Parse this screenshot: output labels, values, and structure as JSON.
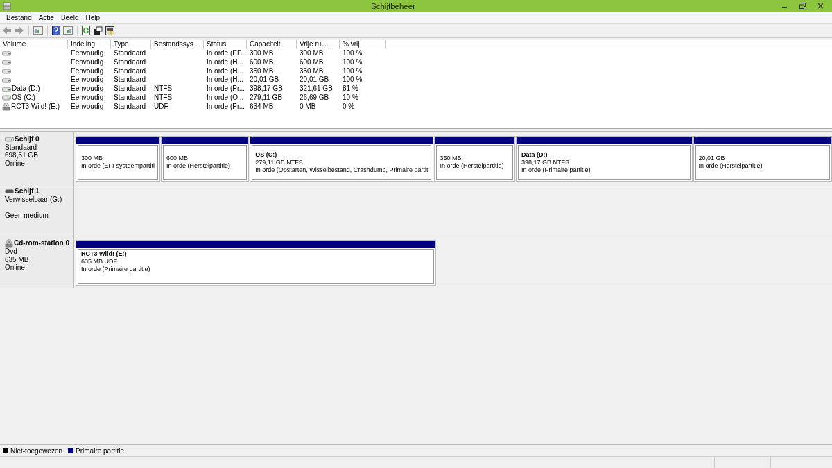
{
  "window": {
    "title": "Schijfbeheer"
  },
  "menu": [
    "Bestand",
    "Actie",
    "Beeld",
    "Help"
  ],
  "volumes": {
    "columns": [
      "Volume",
      "Indeling",
      "Type",
      "Bestandssys...",
      "Status",
      "Capaciteit",
      "Vrije rui...",
      "% vrij"
    ],
    "rows": [
      {
        "kind": "drive",
        "cells": [
          "",
          "Eenvoudig",
          "Standaard",
          "",
          "In orde (EF...",
          "300 MB",
          "300 MB",
          "100 %"
        ]
      },
      {
        "kind": "drive",
        "cells": [
          "",
          "Eenvoudig",
          "Standaard",
          "",
          "In orde (H...",
          "600 MB",
          "600 MB",
          "100 %"
        ]
      },
      {
        "kind": "drive",
        "cells": [
          "",
          "Eenvoudig",
          "Standaard",
          "",
          "In orde (H...",
          "350 MB",
          "350 MB",
          "100 %"
        ]
      },
      {
        "kind": "drive",
        "cells": [
          "",
          "Eenvoudig",
          "Standaard",
          "",
          "In orde (H...",
          "20,01 GB",
          "20,01 GB",
          "100 %"
        ]
      },
      {
        "kind": "drive",
        "cells": [
          "Data (D:)",
          "Eenvoudig",
          "Standaard",
          "NTFS",
          "In orde (Pr...",
          "398,17 GB",
          "321,61 GB",
          "81 %"
        ]
      },
      {
        "kind": "drive",
        "cells": [
          "OS (C:)",
          "Eenvoudig",
          "Standaard",
          "NTFS",
          "In orde (O...",
          "279,11 GB",
          "26,69 GB",
          "10 %"
        ]
      },
      {
        "kind": "cdrom",
        "cells": [
          "RCT3 Wild! (E:)",
          "Eenvoudig",
          "Standaard",
          "UDF",
          "In orde (Pr...",
          "634 MB",
          "0 MB",
          "0 %"
        ]
      }
    ]
  },
  "disks": [
    {
      "kind": "disk",
      "name": "Schijf 0",
      "info": [
        "Standaard",
        "698,51 GB",
        "Online"
      ],
      "partitions": [
        {
          "size": "300 MB",
          "status": "In orde (EFI-systeempartiti"
        },
        {
          "size": "600 MB",
          "status": "In orde (Herstelpartitie)"
        },
        {
          "title": "OS  (C:)",
          "size": "279,11 GB NTFS",
          "status": "In orde (Opstarten, Wisselbestand, Crashdump, Primaire partit"
        },
        {
          "size": "350 MB",
          "status": "In orde (Herstelpartitie)"
        },
        {
          "title": "Data  (D:)",
          "size": "398,17 GB NTFS",
          "status": "In orde (Primaire partitie)"
        },
        {
          "size": "20,01 GB",
          "status": "In orde (Herstelpartitie)"
        }
      ]
    },
    {
      "kind": "removable",
      "name": "Schijf 1",
      "info": [
        "Verwisselbaar (G:)",
        "Geen medium"
      ]
    },
    {
      "kind": "cdrom",
      "name": "Cd-rom-station 0",
      "info": [
        "Dvd",
        "635 MB",
        "Online"
      ],
      "partitions": [
        {
          "title": "RCT3 Wild!  (E:)",
          "size": "635 MB UDF",
          "status": "In orde (Primaire partitie)"
        }
      ]
    }
  ],
  "legend": [
    {
      "label": "Niet-toegewezen",
      "color": "#000000"
    },
    {
      "label": "Primaire partitie",
      "color": "#000080"
    }
  ]
}
